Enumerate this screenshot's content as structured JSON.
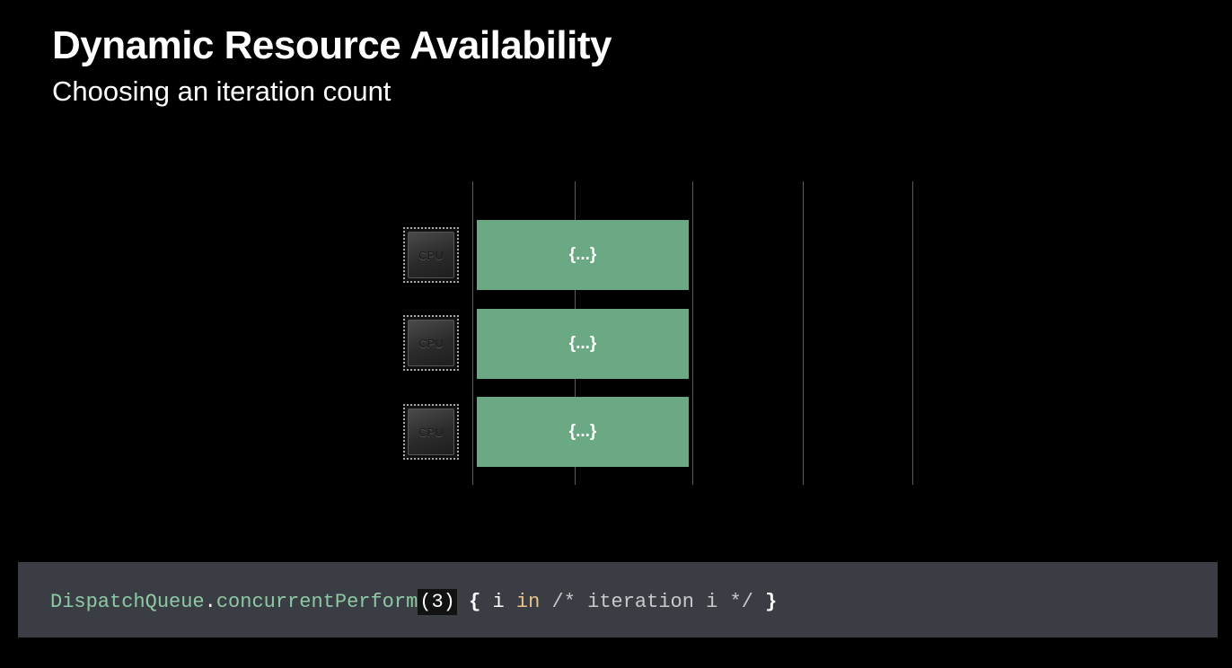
{
  "header": {
    "title": "Dynamic Resource Availability",
    "subtitle": "Choosing an iteration count"
  },
  "diagram": {
    "cpus": [
      {
        "label": "CPU",
        "task": "{...}"
      },
      {
        "label": "CPU",
        "task": "{...}"
      },
      {
        "label": "CPU",
        "task": "{...}"
      }
    ]
  },
  "code": {
    "type_name": "DispatchQueue",
    "dot": ".",
    "method": "concurrentPerform",
    "argument": "(3)",
    "space": " ",
    "open_brace": "{",
    "var": " i ",
    "keyword": "in",
    "comment": " /* iteration i */ ",
    "close_brace": "}"
  },
  "colors": {
    "background": "#000000",
    "task_green": "#6aa983",
    "code_bar": "#3a3e44",
    "type_color": "#8fc9a4",
    "keyword_color": "#e8c48a"
  }
}
